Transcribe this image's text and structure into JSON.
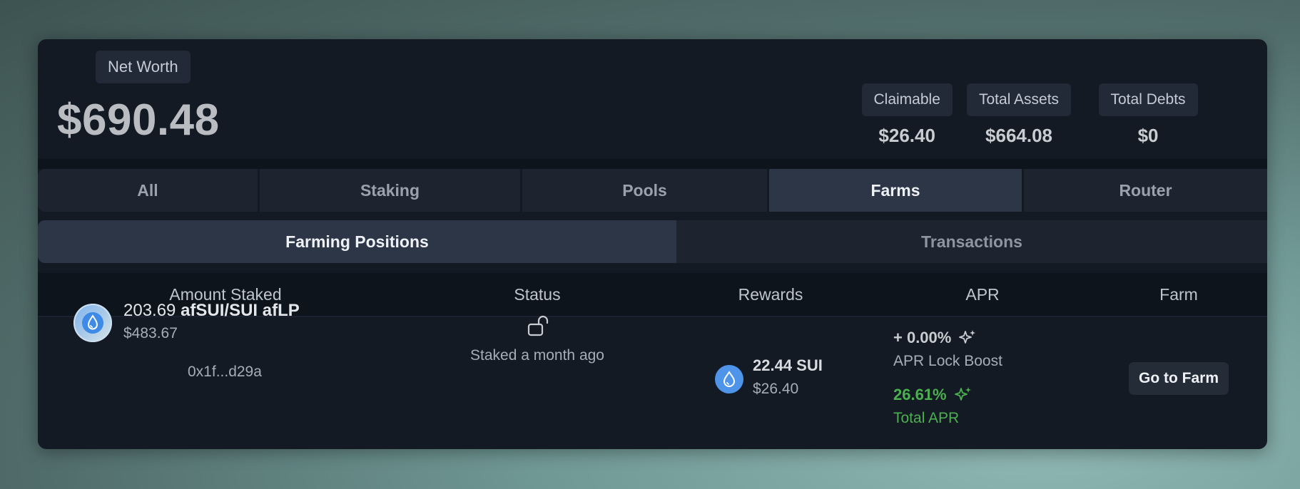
{
  "networth": {
    "label": "Net Worth",
    "value": "$690.48"
  },
  "stats": [
    {
      "label": "Claimable",
      "value": "$26.40"
    },
    {
      "label": "Total Assets",
      "value": "$664.08"
    },
    {
      "label": "Total Debts",
      "value": "$0"
    }
  ],
  "tabs": [
    {
      "label": "All",
      "active": false
    },
    {
      "label": "Staking",
      "active": false
    },
    {
      "label": "Pools",
      "active": false
    },
    {
      "label": "Farms",
      "active": true
    },
    {
      "label": "Router",
      "active": false
    }
  ],
  "subtabs": [
    {
      "label": "Farming Positions",
      "active": true
    },
    {
      "label": "Transactions",
      "active": false
    }
  ],
  "table": {
    "headers": [
      "Amount Staked",
      "Status",
      "Rewards",
      "APR",
      "Farm"
    ],
    "rows": [
      {
        "amount_number": "203.69",
        "amount_token": "afSUI/SUI afLP",
        "amount_usd": "$483.67",
        "address": "0x1f...d29a",
        "status": "Staked a month ago",
        "status_icon": "unlocked-padlock-icon",
        "reward_amount": "22.44 SUI",
        "reward_usd": "$26.40",
        "apr_boost": "+ 0.00%",
        "apr_boost_label": "APR Lock Boost",
        "apr_total": "26.61%",
        "apr_total_label": "Total APR",
        "farm_button": "Go to Farm"
      }
    ]
  },
  "colors": {
    "card_bg": "#131a24",
    "tab_active_bg": "#2c3647",
    "apr_green": "#4caf50",
    "sui_blue": "#4e95ea"
  }
}
